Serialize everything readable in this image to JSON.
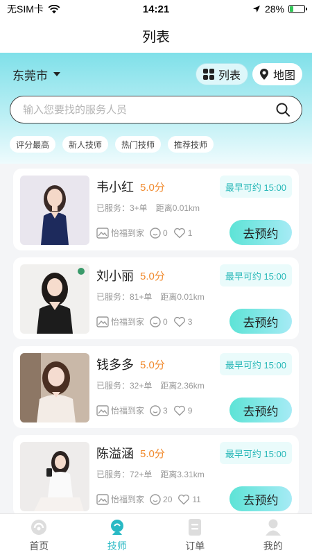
{
  "status_bar": {
    "carrier": "无SIM卡",
    "time": "14:21",
    "battery": "28%",
    "battery_level": 0.28
  },
  "page_title": "列表",
  "header": {
    "city": "东莞市",
    "view_list_label": "列表",
    "view_map_label": "地图"
  },
  "search": {
    "placeholder": "输入您要找的服务人员"
  },
  "filters": [
    "评分最高",
    "新人技师",
    "热门技师",
    "推荐技师"
  ],
  "colors": {
    "accent": "#29b9c4",
    "rating": "#f0892c",
    "availability_bg": "#eafbfb"
  },
  "technicians": [
    {
      "name": "韦小红",
      "rating": "5.0分",
      "availability": "最早可约 15:00",
      "served": "已服务：3+单",
      "distance": "距离0.01km",
      "shop": "怡福到家",
      "comments": "0",
      "likes": "1",
      "book_label": "去预约"
    },
    {
      "name": "刘小丽",
      "rating": "5.0分",
      "availability": "最早可约 15:00",
      "served": "已服务：81+单",
      "distance": "距离0.01km",
      "shop": "怡福到家",
      "comments": "0",
      "likes": "3",
      "book_label": "去预约"
    },
    {
      "name": "钱多多",
      "rating": "5.0分",
      "availability": "最早可约 15:00",
      "served": "已服务：32+单",
      "distance": "距离2.36km",
      "shop": "怡福到家",
      "comments": "3",
      "likes": "9",
      "book_label": "去预约"
    },
    {
      "name": "陈溢涵",
      "rating": "5.0分",
      "availability": "最早可约 15:00",
      "served": "已服务：72+单",
      "distance": "距离3.31km",
      "shop": "怡福到家",
      "comments": "20",
      "likes": "11",
      "book_label": "去预约"
    }
  ],
  "tabs": [
    {
      "label": "首页",
      "icon": "home-icon",
      "active": false
    },
    {
      "label": "技师",
      "icon": "technician-icon",
      "active": true
    },
    {
      "label": "订单",
      "icon": "order-icon",
      "active": false
    },
    {
      "label": "我的",
      "icon": "profile-icon",
      "active": false
    }
  ]
}
